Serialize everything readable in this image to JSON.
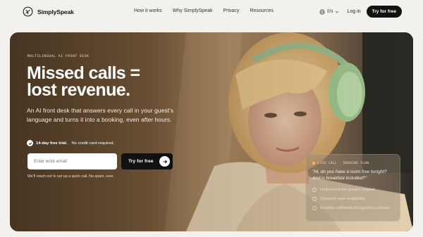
{
  "nav": {
    "brand": "SimplySpeak",
    "links": [
      "How it works",
      "Why SimplySpeak",
      "Privacy",
      "Resources"
    ],
    "lang": "EN",
    "login": "Log in",
    "cta": "Try for free"
  },
  "hero": {
    "kicker": "MULTILINGUAL AI FRONT DESK",
    "headline_1": "Missed calls =",
    "headline_2": "lost revenue.",
    "subtitle": "An AI front desk that answers every call in your guest's language and turns it into a booking, even after hours.",
    "trial_bold": "14-day free trial.",
    "trial_rest": "No credit card required.",
    "email_placeholder": "Enter work email",
    "cta": "Try for free",
    "note": "We'll reach out to set up a quick call. No spam, ever."
  },
  "live_card": {
    "header": "LIVE CALL · BOOKING FLOW",
    "quote": "\"Hi, do you have a room free tonight? And is breakfast included?\"",
    "steps": [
      "Understand the guest's request",
      "Checked room availability",
      "Booking confirmed & logged to calendar"
    ]
  },
  "colors": {
    "accent": "#111111",
    "live_dot": "#ffb45a"
  }
}
